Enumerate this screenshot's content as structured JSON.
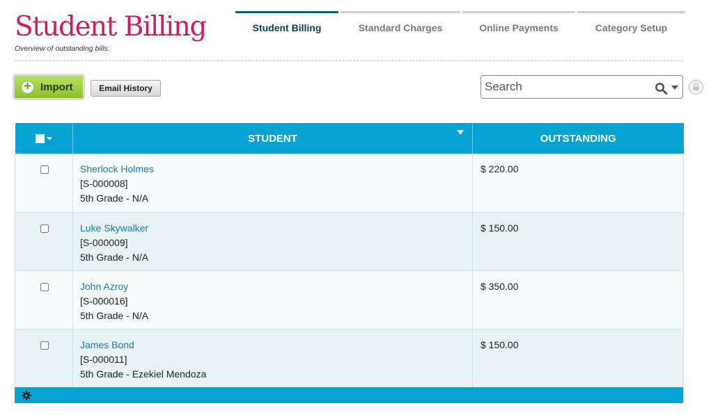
{
  "header": {
    "title": "Student Billing",
    "subtitle": "Overview of outstanding bills."
  },
  "tabs": [
    {
      "label": "Student Billing",
      "active": true
    },
    {
      "label": "Standard Charges",
      "active": false
    },
    {
      "label": "Online Payments",
      "active": false
    },
    {
      "label": "Category Setup",
      "active": false
    }
  ],
  "toolbar": {
    "import_label": "Import",
    "email_history_label": "Email History",
    "search_placeholder": "Search"
  },
  "table": {
    "columns": [
      "STUDENT",
      "OUTSTANDING"
    ],
    "rows": [
      {
        "name": "Sherlock Holmes",
        "id": "[S-000008]",
        "grade": "5th Grade - N/A",
        "outstanding": "$ 220.00"
      },
      {
        "name": "Luke Skywalker",
        "id": "[S-000009]",
        "grade": "5th Grade - N/A",
        "outstanding": "$ 150.00"
      },
      {
        "name": "John Azroy",
        "id": "[S-000016]",
        "grade": "5th Grade - N/A",
        "outstanding": "$ 350.00"
      },
      {
        "name": "James Bond",
        "id": "[S-000011]",
        "grade": "5th Grade - Ezekiel Mendoza",
        "outstanding": "$ 150.00"
      }
    ]
  },
  "colors": {
    "brand_title": "#cc1f5a",
    "table_header": "#05a2d2",
    "active_tab": "#0c5f75",
    "link": "#1a7ea7",
    "import_button": "#9ccb3a"
  },
  "icons": [
    "plus-icon",
    "search-icon",
    "caret-down-icon",
    "lock-icon",
    "sort-icon",
    "gear-icon"
  ]
}
